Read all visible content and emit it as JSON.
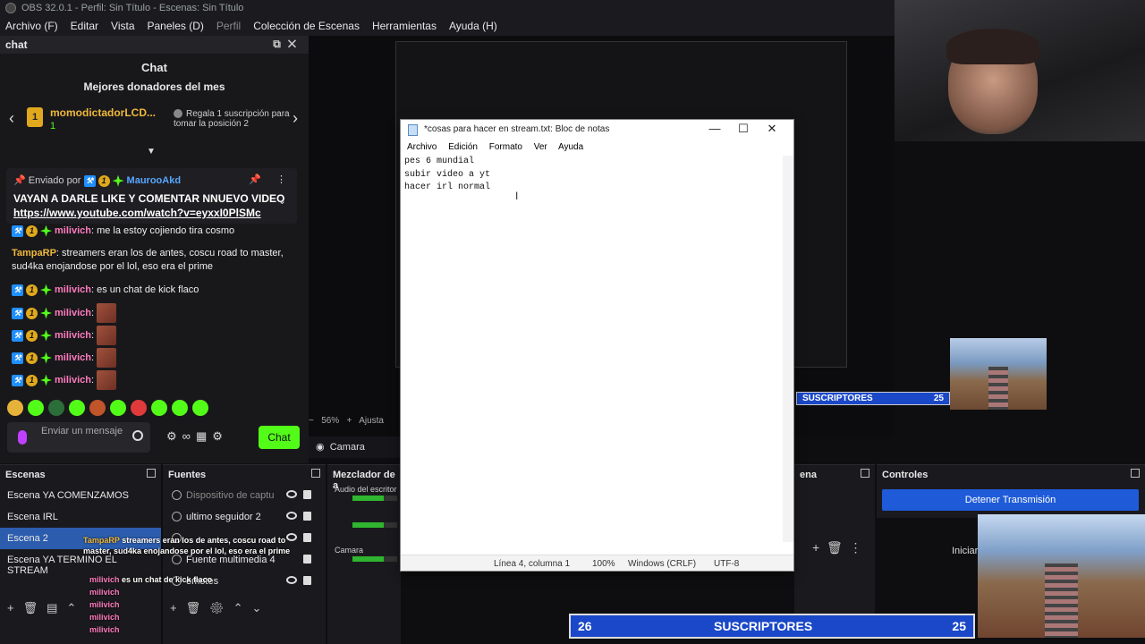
{
  "titlebar": {
    "title": "OBS 32.0.1 - Perfil: Sin Título - Escenas: Sin Título"
  },
  "menubar": [
    "Archivo (F)",
    "Editar",
    "Vista",
    "Paneles (D)",
    "Perfil",
    "Colección de Escenas",
    "Herramientas",
    "Ayuda (H)"
  ],
  "chat_dock": {
    "header": "chat",
    "title": "Chat",
    "donors_title": "Mejores donadores del mes",
    "donor": {
      "name": "momodictadorLCD...",
      "count": "1",
      "rank": "1",
      "cta": "Regala 1 suscripción para tomar la posición 2"
    },
    "pinned": {
      "sent_by": "Enviado por",
      "user": "MaurooAkd",
      "message": "VAYAN A DARLE LIKE Y COMENTAR NNUEVO VIDEO",
      "link": "https://www.youtube.com/watch?v=eyxxI0PlSMc"
    },
    "messages": [
      {
        "user": "milivich",
        "text": ": me la estoy cojiendo tira cosmo"
      },
      {
        "user": "TampaRP",
        "text": ": streamers eran los de antes, coscu road to master, sud4ka enojandose por el lol, eso era el prime"
      },
      {
        "user": "milivich",
        "text": ": es un chat de kick flaco"
      },
      {
        "user": "milivich",
        "text": ":"
      },
      {
        "user": "milivich",
        "text": ":"
      },
      {
        "user": "milivich",
        "text": ":"
      },
      {
        "user": "milivich",
        "text": ":"
      }
    ],
    "input_placeholder": "Enviar un mensaje",
    "send_label": "Chat",
    "emote_colors": [
      "#e7b23a",
      "#53fc18",
      "#2c6e3a",
      "#53fc18",
      "#c0552a",
      "#53fc18",
      "#e03a3a",
      "#53fc18",
      "#53fc18",
      "#53fc18"
    ]
  },
  "preview": {
    "zoom": "56%",
    "adjust": "Ajusta",
    "camara": "Camara"
  },
  "notepad": {
    "title": "*cosas para hacer en stream.txt: Bloc de notas",
    "menu": [
      "Archivo",
      "Edición",
      "Formato",
      "Ver",
      "Ayuda"
    ],
    "text": "pes 6 mundial\nsubir video a yt\nhacer irl normal\n",
    "status": {
      "position": "Línea 4, columna 1",
      "zoom": "100%",
      "eol": "Windows (CRLF)",
      "encoding": "UTF-8"
    }
  },
  "scenes": {
    "header": "Escenas",
    "items": [
      "Escena YA COMENZAMOS",
      "Escena IRL",
      "Escena 2",
      "Escena YA TERMINO EL STREAM"
    ],
    "selected": 2
  },
  "sources": {
    "header": "Fuentes",
    "items": [
      "Dispositivo de captu",
      "ultimo seguidor 2",
      "",
      "Fuente multimedia 4",
      "emotes"
    ]
  },
  "mixer": {
    "header": "Mezclador de a",
    "tracks": [
      "Audio del escritor",
      "Camara"
    ]
  },
  "transitions": {
    "header": "ena"
  },
  "controls": {
    "header": "Controles",
    "stop_stream": "Detener Transmisión",
    "start": "Iniciar"
  },
  "subs": {
    "left": "26",
    "label": "SUSCRIPTORES",
    "right": "25"
  },
  "subs_small": {
    "label": "SUSCRIPTORES",
    "right": "25"
  },
  "overlay_chat": {
    "user": "TampaRP",
    "text": "streamers eran los de antes, coscu road to master, sud4ka enojandose por el lol, eso era el prime",
    "chat": "es un chat de kick flaco",
    "milivich": "milivich"
  }
}
